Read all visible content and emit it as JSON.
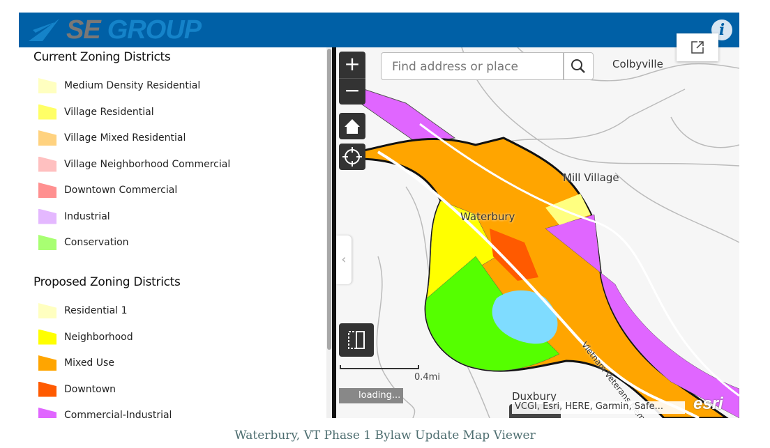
{
  "header": {
    "logo_text_1": "SE",
    "logo_text_2": "GROUP",
    "info_icon": "i"
  },
  "legend": {
    "current": {
      "title": "Current Zoning Districts",
      "items": [
        {
          "label": "Medium Density Residential",
          "color": "#ffffc0"
        },
        {
          "label": "Village Residential",
          "color": "#ffff66"
        },
        {
          "label": "Village Mixed Residential",
          "color": "#ffd27f"
        },
        {
          "label": "Village Neighborhood Commercial",
          "color": "#ffc0c0"
        },
        {
          "label": "Downtown Commercial",
          "color": "#ff9090"
        },
        {
          "label": "Industrial",
          "color": "#e4b8ff"
        },
        {
          "label": "Conservation",
          "color": "#a8ff72"
        }
      ]
    },
    "proposed": {
      "title": "Proposed Zoning Districts",
      "items": [
        {
          "label": "Residential 1",
          "color": "#ffffc0"
        },
        {
          "label": "Neighborhood",
          "color": "#ffff00"
        },
        {
          "label": "Mixed Use",
          "color": "#ffa500"
        },
        {
          "label": "Downtown",
          "color": "#ff5a00"
        },
        {
          "label": "Commercial-Industrial",
          "color": "#e066ff"
        }
      ]
    }
  },
  "map": {
    "search_placeholder": "Find address or place",
    "zoom_in": "+",
    "zoom_out": "−",
    "places": [
      "Colbyville",
      "Mill Village",
      "Waterbury",
      "Duxbury"
    ],
    "road_label": "Vietnam Veterans Memorial Hwy",
    "scale_label": "0.4mi",
    "loading": "loading...",
    "attribution": "VCGI, Esri, HERE, Garmin, Safe...",
    "esri": "esri"
  },
  "footer": {
    "title": "Waterbury, VT Phase 1 Bylaw Update Map Viewer"
  }
}
